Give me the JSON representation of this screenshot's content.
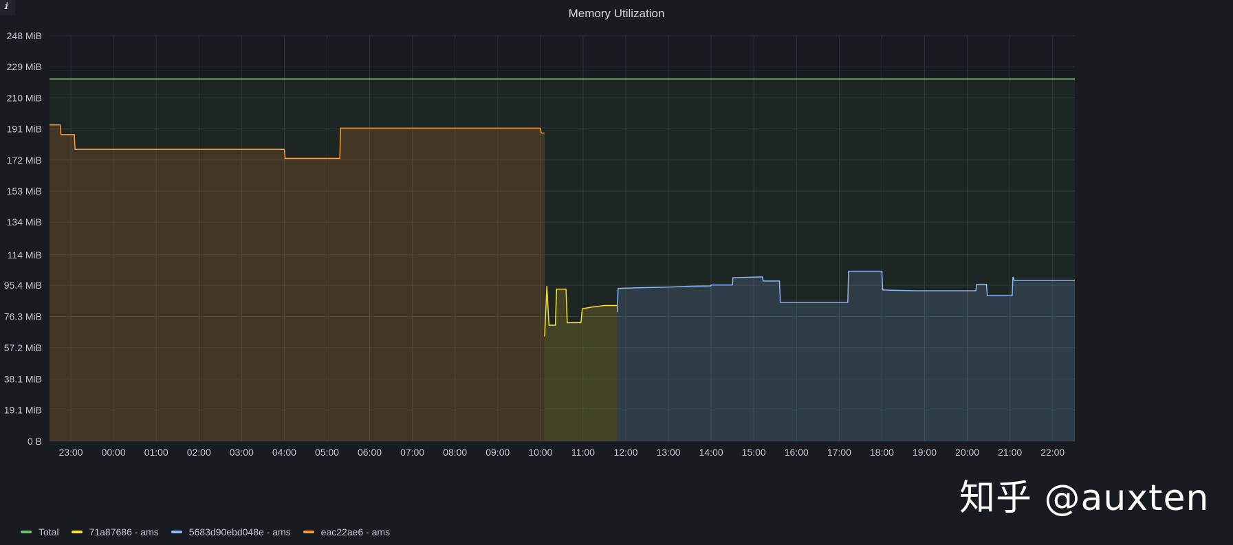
{
  "panel": {
    "title": "Memory Utilization",
    "info_icon": "ℹ",
    "watermark": "知乎 @auxten"
  },
  "colors": {
    "background": "#181b1f",
    "grid": "#2c3038",
    "total": "#73bf69",
    "yellow": "#fade2a",
    "blue": "#8ab8ff",
    "orange": "#ff9830"
  },
  "chart_data": {
    "type": "area",
    "title": "Memory Utilization",
    "xlabel": "",
    "ylabel": "",
    "y_unit": "MiB",
    "ylim": [
      0,
      248
    ],
    "y_ticks": [
      "0 B",
      "19.1 MiB",
      "38.1 MiB",
      "57.2 MiB",
      "76.3 MiB",
      "95.4 MiB",
      "114 MiB",
      "134 MiB",
      "153 MiB",
      "172 MiB",
      "191 MiB",
      "210 MiB",
      "229 MiB",
      "248 MiB"
    ],
    "y_tick_values": [
      0,
      19.1,
      38.1,
      57.2,
      76.3,
      95.4,
      114,
      134,
      153,
      172,
      191,
      210,
      229,
      248
    ],
    "x_ticks": [
      "23:00",
      "00:00",
      "01:00",
      "02:00",
      "03:00",
      "04:00",
      "05:00",
      "06:00",
      "07:00",
      "08:00",
      "09:00",
      "10:00",
      "11:00",
      "12:00",
      "13:00",
      "14:00",
      "15:00",
      "16:00",
      "17:00",
      "18:00",
      "19:00",
      "20:00",
      "21:00",
      "22:00"
    ],
    "x_tick_hours": [
      23,
      24,
      25,
      26,
      27,
      28,
      29,
      30,
      31,
      32,
      33,
      34,
      35,
      36,
      37,
      38,
      39,
      40,
      41,
      42,
      43,
      44,
      45,
      46
    ],
    "xlim_hours": [
      22.5,
      46.52
    ],
    "x_note": "hours counted from 00:00 of the first day; 24 = 00:00 next day",
    "legend_position": "bottom-left",
    "grid": true,
    "series": [
      {
        "name": "Total",
        "color": "#73bf69",
        "fill": true,
        "points": [
          [
            22.5,
            221.5
          ],
          [
            46.52,
            221.5
          ]
        ]
      },
      {
        "name": "71a87686 - ams",
        "color": "#fade2a",
        "fill": true,
        "points": [
          [
            34.1,
            64
          ],
          [
            34.15,
            95
          ],
          [
            34.2,
            71
          ],
          [
            34.35,
            71
          ],
          [
            34.38,
            93
          ],
          [
            34.6,
            93
          ],
          [
            34.63,
            72.5
          ],
          [
            34.95,
            72.5
          ],
          [
            34.98,
            81
          ],
          [
            35.2,
            82
          ],
          [
            35.5,
            83
          ],
          [
            35.8,
            83
          ]
        ]
      },
      {
        "name": "5683d90ebd048e - ams",
        "color": "#8ab8ff",
        "fill": true,
        "points": [
          [
            35.8,
            79
          ],
          [
            35.82,
            93.5
          ],
          [
            36.5,
            94
          ],
          [
            37,
            94.3
          ],
          [
            37.5,
            94.8
          ],
          [
            37.99,
            95
          ],
          [
            38,
            95.5
          ],
          [
            38.5,
            95.5
          ],
          [
            38.51,
            100
          ],
          [
            39.2,
            100.5
          ],
          [
            39.22,
            98
          ],
          [
            39.6,
            98
          ],
          [
            39.62,
            85
          ],
          [
            41.2,
            85
          ],
          [
            41.22,
            104
          ],
          [
            42.0,
            104
          ],
          [
            42.02,
            92.5
          ],
          [
            42.8,
            92
          ],
          [
            43.5,
            92
          ],
          [
            44.2,
            92
          ],
          [
            44.22,
            96
          ],
          [
            44.45,
            96
          ],
          [
            44.47,
            89
          ],
          [
            45.05,
            89
          ],
          [
            45.07,
            100.5
          ],
          [
            45.1,
            98.5
          ],
          [
            46.52,
            98.5
          ]
        ]
      },
      {
        "name": "eac22ae6 - ams",
        "color": "#ff9830",
        "fill": true,
        "points": [
          [
            22.5,
            193.5
          ],
          [
            22.75,
            193.5
          ],
          [
            22.77,
            187.5
          ],
          [
            23.08,
            187.5
          ],
          [
            23.1,
            178.5
          ],
          [
            26,
            178.5
          ],
          [
            28,
            178.5
          ],
          [
            28.02,
            173
          ],
          [
            29.3,
            173
          ],
          [
            29.32,
            191.5
          ],
          [
            34,
            191.5
          ],
          [
            34.02,
            188.5
          ],
          [
            34.1,
            188.5
          ]
        ]
      }
    ]
  },
  "legend": {
    "items": [
      {
        "label": "Total",
        "color": "#73bf69"
      },
      {
        "label": "71a87686 - ams",
        "color": "#fade2a"
      },
      {
        "label": "5683d90ebd048e - ams",
        "color": "#8ab8ff"
      },
      {
        "label": "eac22ae6 - ams",
        "color": "#ff9830"
      }
    ]
  }
}
